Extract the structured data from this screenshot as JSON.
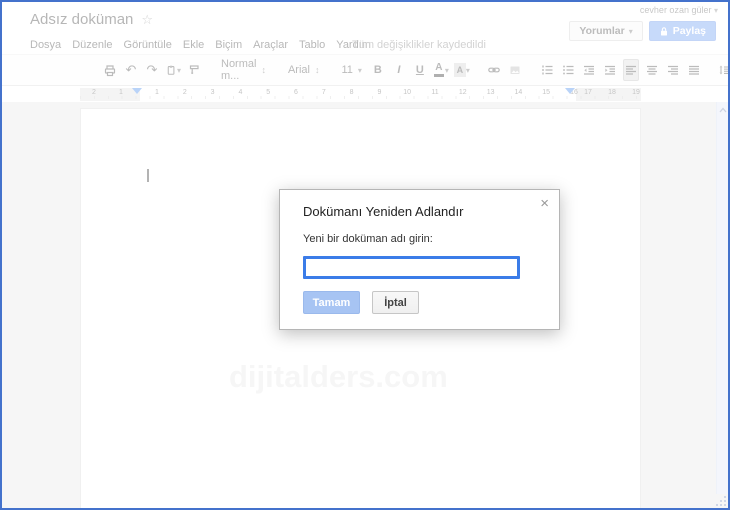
{
  "header": {
    "account_label": "cevher ozan güler",
    "doc_title": "Adsız doküman",
    "star_icon": "☆",
    "menu_items": [
      "Dosya",
      "Düzenle",
      "Görüntüle",
      "Ekle",
      "Biçim",
      "Araçlar",
      "Tablo",
      "Yardım"
    ],
    "save_status": "Tüm değişiklikler kaydedildi",
    "comments_button_label": "Yorumlar",
    "share_button_label": "Paylaş",
    "dropdown_caret": "▾"
  },
  "toolbar": {
    "undo_icon": "↶",
    "redo_icon": "↷",
    "style_dropdown_value": "Normal m...",
    "font_dropdown_value": "Arial",
    "font_size_value": "11",
    "bold_label": "B",
    "italic_label": "I",
    "underline_label": "U",
    "text_color_label": "A",
    "highlight_label": "A",
    "updown_icon": "↕",
    "caret_icon": "▾",
    "scroll_up_icon": "∧"
  },
  "ruler": {
    "left_numbers": [
      "2",
      "1"
    ],
    "center_numbers": [
      "1",
      "2",
      "3",
      "4",
      "5",
      "6",
      "7",
      "8",
      "9",
      "10",
      "11",
      "12",
      "13",
      "14",
      "15",
      "16"
    ],
    "right_numbers": [
      "17",
      "18",
      "19"
    ]
  },
  "document": {
    "watermark": "dijitalders.com"
  },
  "dialog": {
    "title": "Dokümanı Yeniden Adlandır",
    "close_icon": "×",
    "label": "Yeni bir doküman adı girin:",
    "input_value": "",
    "ok_button_label": "Tamam",
    "cancel_button_label": "İptal"
  },
  "colors": {
    "window_border": "#4472cc",
    "input_focus_border": "#3b7ce8",
    "ok_button_bg": "#a7c4f3",
    "share_button_bg": "#8fb4f5",
    "ruler_marker_blue": "#73a7f0"
  }
}
